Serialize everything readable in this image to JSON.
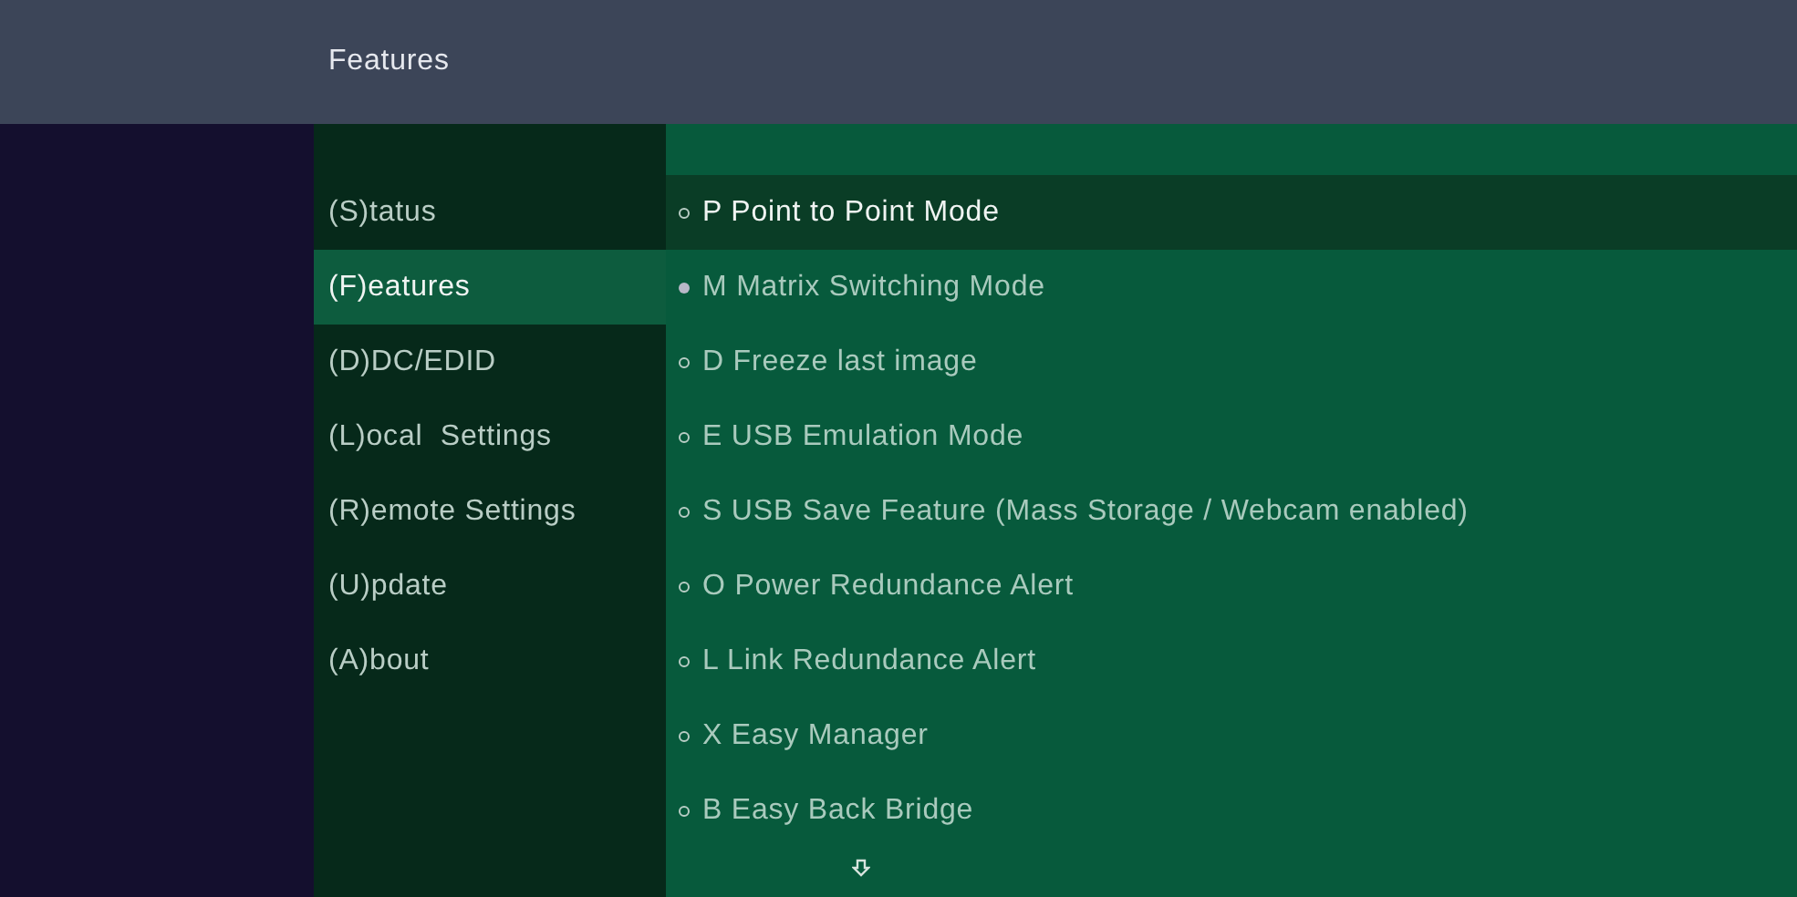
{
  "header": {
    "title": "Features"
  },
  "menu": [
    {
      "label": "(S)tatus",
      "selected": false
    },
    {
      "label": "(F)eatures",
      "selected": true
    },
    {
      "label": "(D)DC/EDID",
      "selected": false
    },
    {
      "label": "(L)ocal  Settings",
      "selected": false
    },
    {
      "label": "(R)emote Settings",
      "selected": false
    },
    {
      "label": "(U)pdate",
      "selected": false
    },
    {
      "label": "(A)bout",
      "selected": false
    }
  ],
  "features": [
    {
      "label": "P Point to Point Mode",
      "selected": false,
      "focused": true
    },
    {
      "label": "M Matrix Switching Mode",
      "selected": true,
      "focused": false
    },
    {
      "label": "D Freeze last image",
      "selected": false,
      "focused": false
    },
    {
      "label": "E USB Emulation Mode",
      "selected": false,
      "focused": false
    },
    {
      "label": "S USB Save Feature (Mass Storage / Webcam enabled)",
      "selected": false,
      "focused": false
    },
    {
      "label": "O Power Redundance Alert",
      "selected": false,
      "focused": false
    },
    {
      "label": "L Link Redundance Alert",
      "selected": false,
      "focused": false
    },
    {
      "label": "X Easy Manager",
      "selected": false,
      "focused": false
    },
    {
      "label": "B Easy Back Bridge",
      "selected": false,
      "focused": false
    }
  ]
}
